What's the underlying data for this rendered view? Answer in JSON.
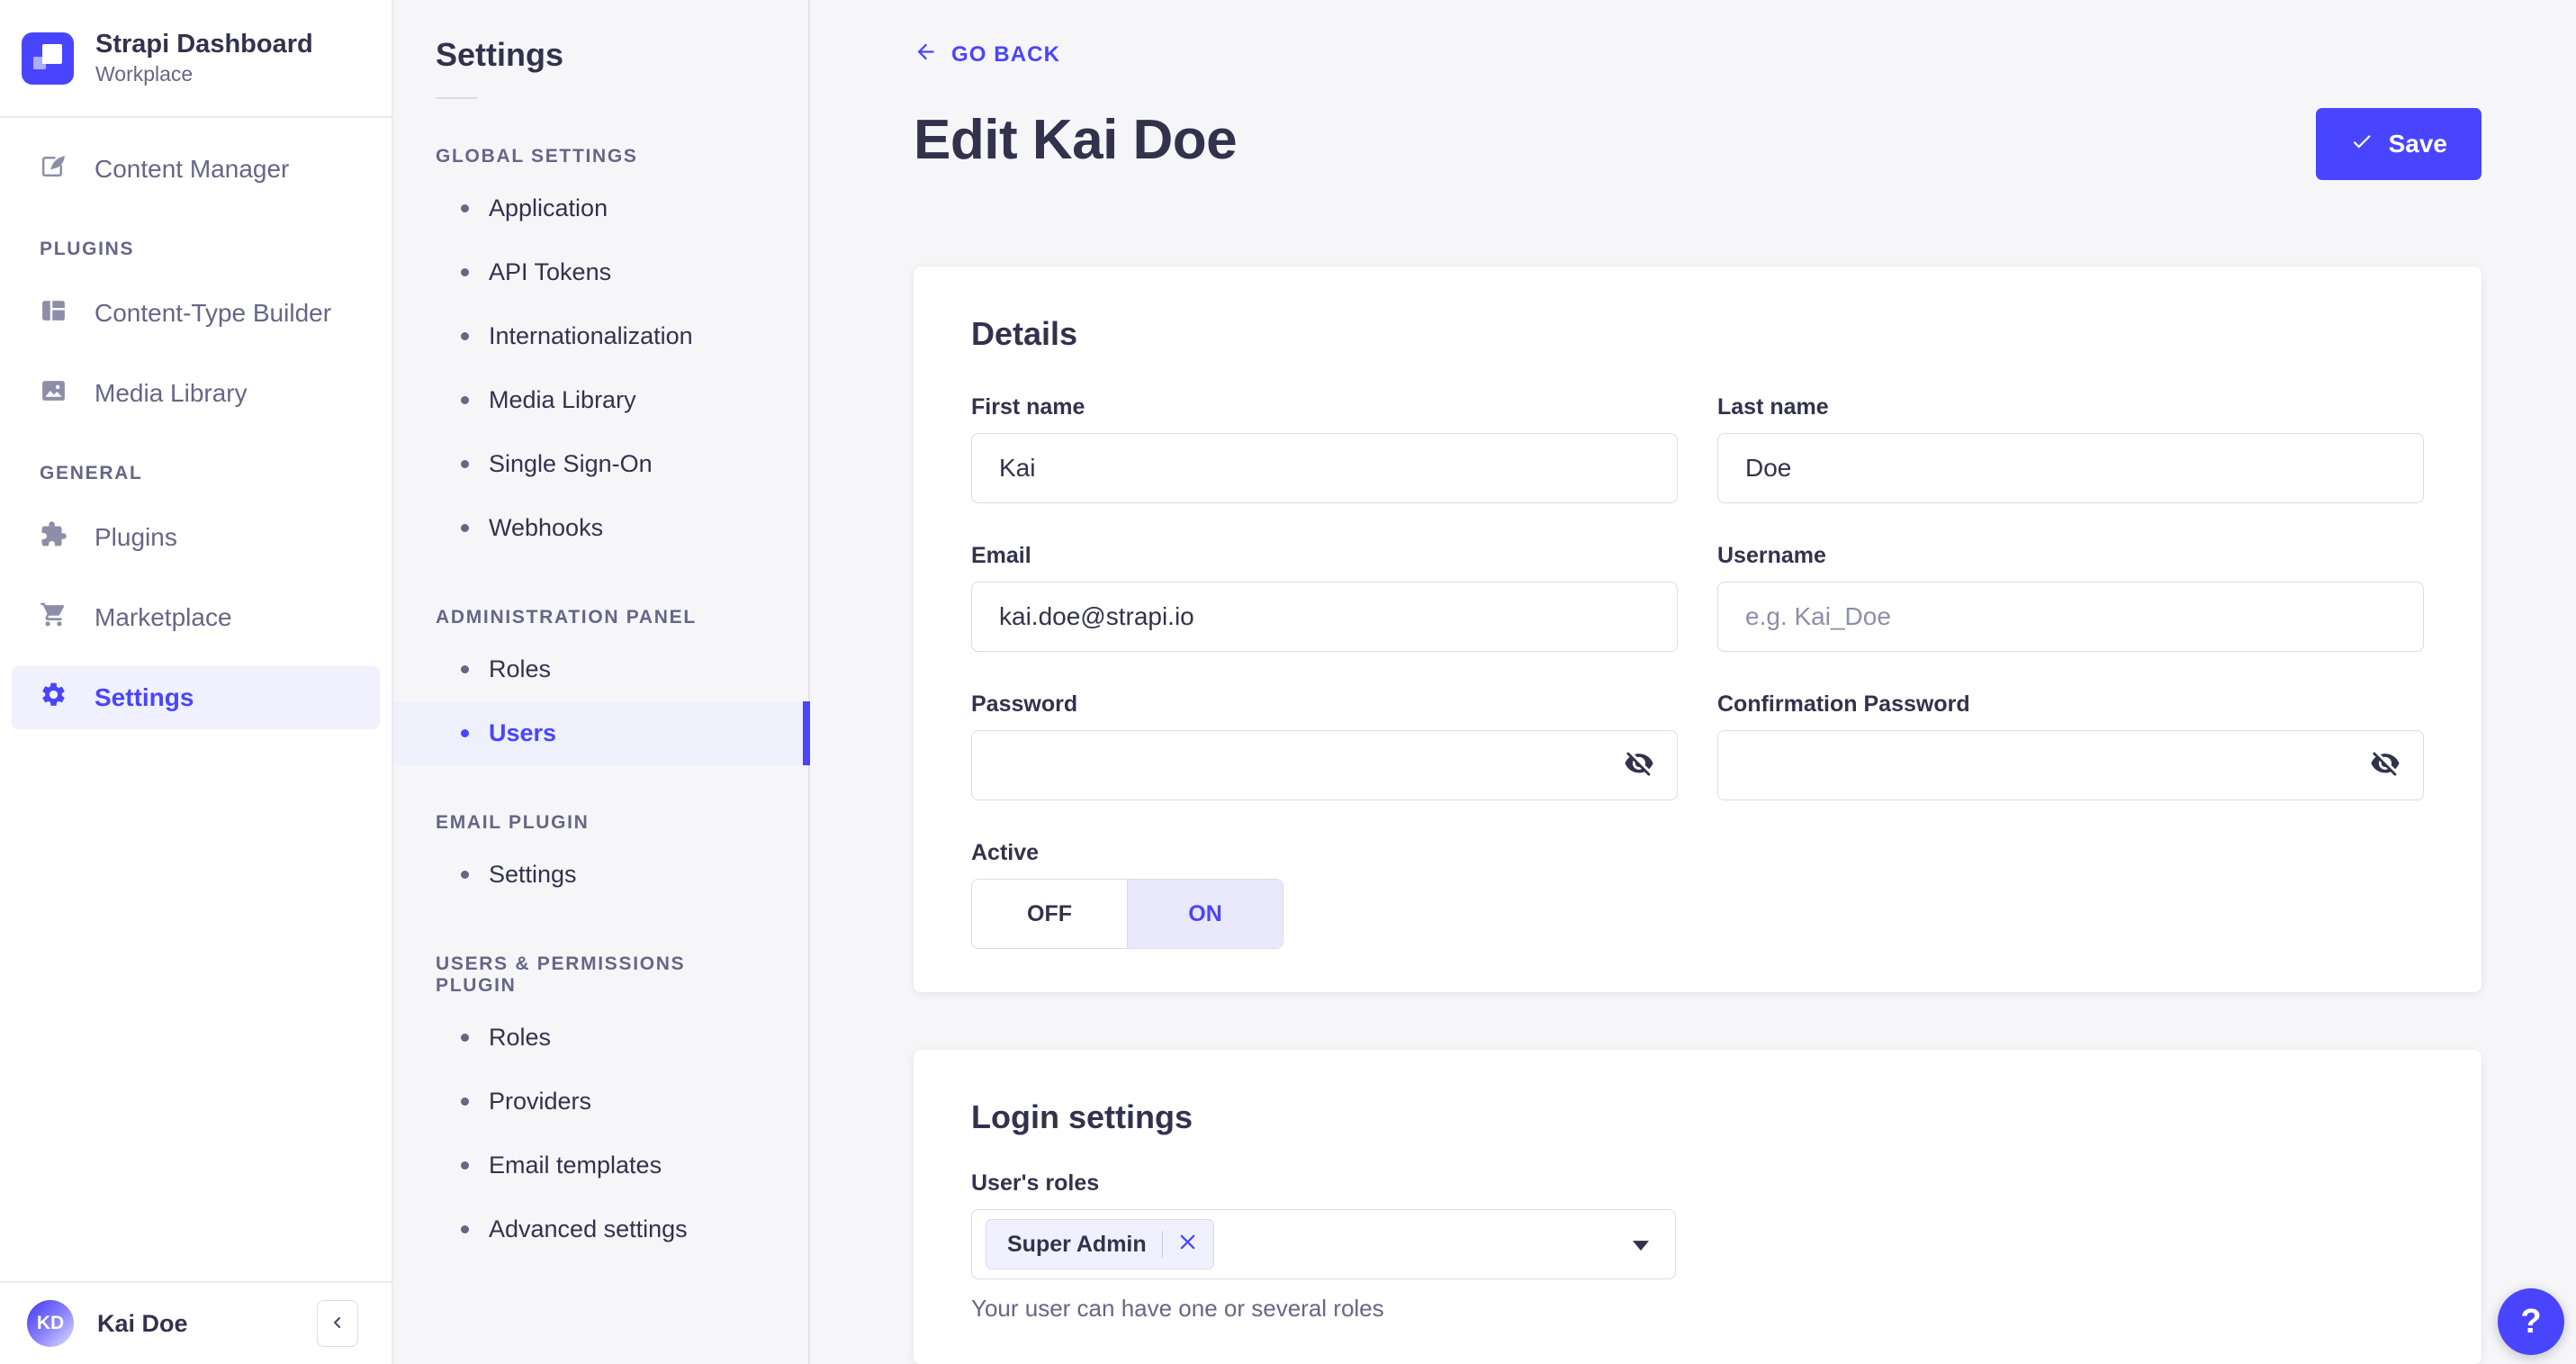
{
  "colors": {
    "primary": "#4945ff",
    "primary_light": "#f0f0ff",
    "background": "#f6f6f9",
    "card": "#ffffff",
    "border": "#dcdce4",
    "text": "#32324d",
    "text_muted": "#666687",
    "placeholder": "#8e8ea9"
  },
  "sidebar": {
    "brand": {
      "name": "Strapi Dashboard",
      "workspace": "Workplace",
      "icon": "strapi-logo"
    },
    "content_manager": {
      "label": "Content Manager",
      "icon": "feather-icon"
    },
    "sections": [
      {
        "title": "PLUGINS",
        "items": [
          {
            "label": "Content-Type Builder",
            "icon": "layout-icon"
          },
          {
            "label": "Media Library",
            "icon": "image-icon"
          }
        ]
      },
      {
        "title": "GENERAL",
        "items": [
          {
            "label": "Plugins",
            "icon": "puzzle-icon"
          },
          {
            "label": "Marketplace",
            "icon": "cart-icon"
          },
          {
            "label": "Settings",
            "icon": "gear-icon",
            "active": true
          }
        ]
      }
    ],
    "footer": {
      "initials": "KD",
      "name": "Kai Doe",
      "collapse_icon": "chevron-left-icon"
    }
  },
  "settings_nav": {
    "title": "Settings",
    "sections": [
      {
        "title": "GLOBAL SETTINGS",
        "items": [
          "Application",
          "API Tokens",
          "Internationalization",
          "Media Library",
          "Single Sign-On",
          "Webhooks"
        ]
      },
      {
        "title": "ADMINISTRATION PANEL",
        "items": [
          "Roles",
          "Users"
        ],
        "active_item": "Users"
      },
      {
        "title": "EMAIL PLUGIN",
        "items": [
          "Settings"
        ]
      },
      {
        "title": "USERS & PERMISSIONS PLUGIN",
        "items": [
          "Roles",
          "Providers",
          "Email templates",
          "Advanced settings"
        ]
      }
    ]
  },
  "header": {
    "back_label": "GO BACK",
    "title": "Edit Kai Doe",
    "save_label": "Save"
  },
  "details_card": {
    "heading": "Details",
    "first_name": {
      "label": "First name",
      "value": "Kai"
    },
    "last_name": {
      "label": "Last name",
      "value": "Doe"
    },
    "email": {
      "label": "Email",
      "value": "kai.doe@strapi.io"
    },
    "username": {
      "label": "Username",
      "placeholder": "e.g. Kai_Doe"
    },
    "password": {
      "label": "Password",
      "icon": "eye-off-icon"
    },
    "confirmation_password": {
      "label": "Confirmation Password",
      "icon": "eye-off-icon"
    },
    "active": {
      "label": "Active",
      "off_label": "OFF",
      "on_label": "ON",
      "selected": "ON"
    }
  },
  "login_card": {
    "heading": "Login settings",
    "roles_label": "User's roles",
    "selected_roles": [
      "Super Admin"
    ],
    "remove_icon": "x-icon",
    "dropdown_icon": "chevron-down-icon",
    "helper": "Your user can have one or several roles"
  },
  "help": {
    "label": "?"
  }
}
